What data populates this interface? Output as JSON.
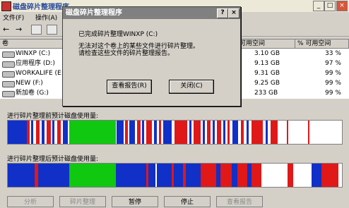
{
  "window": {
    "title": "磁盘碎片整理程序",
    "btn_min": "_",
    "btn_max": "□",
    "btn_close": "×"
  },
  "menu": [
    "文件(F)",
    "操作(A)"
  ],
  "toolbar": {
    "back": "←",
    "forward": "→"
  },
  "columns": {
    "volume": "卷",
    "free": "可用空间",
    "pct": "% 可用空间"
  },
  "volumes": [
    {
      "name": "WINXP (C:)",
      "free": "3.10 GB",
      "pct": "33 %"
    },
    {
      "name": "应用程序 (D:)",
      "free": "9.13 GB",
      "pct": "97 %"
    },
    {
      "name": "WORKALIFE (E:)",
      "free": "9.31 GB",
      "pct": "99 %"
    },
    {
      "name": "NEW (F:)",
      "free": "9.25 GB",
      "pct": "99 %"
    },
    {
      "name": "新加卷 (G:)",
      "free": "233 GB",
      "pct": "99 %"
    }
  ],
  "labels": {
    "before": "进行碎片整理前预计磁盘使用量:",
    "after": "进行碎片整理后预计磁盘使用量:"
  },
  "buttons": {
    "analyze": "分析",
    "defrag": "碎片整理",
    "pause": "暂停",
    "stop": "停止",
    "report": "查看报告"
  },
  "dialog": {
    "title": "磁盘碎片整理程序",
    "help": "?",
    "close": "×",
    "message1": "已完成碎片整理WINXP (C:)",
    "message2": "无法对这个卷上的某些文件进行碎片整理。",
    "message3": "请检查这些文件的碎片整理报告。",
    "view_report": "查看报告(R)",
    "close_btn": "关闭(C)"
  },
  "colors": {
    "fragmented": "#e01818",
    "contiguous": "#1030c8",
    "system": "#10c810",
    "free": "#ffffff"
  }
}
